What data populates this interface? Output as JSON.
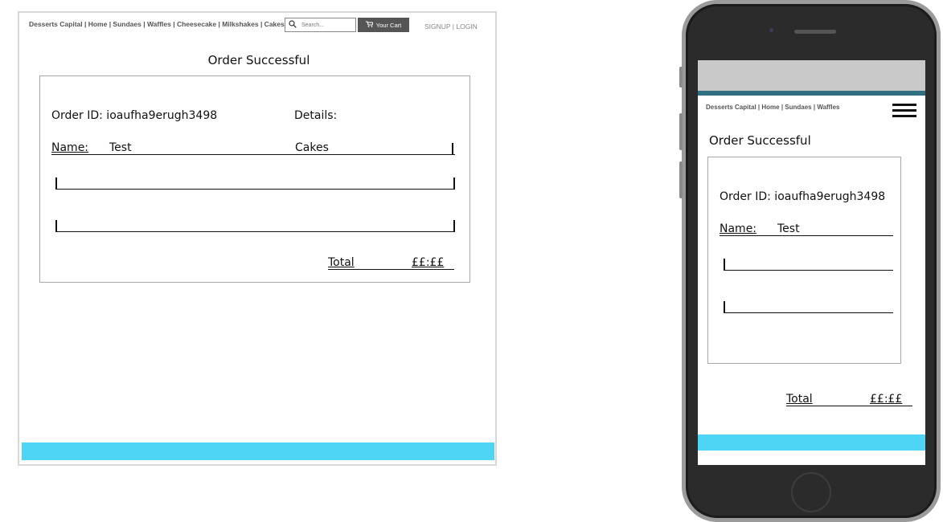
{
  "desktop": {
    "nav": "Desserts Capital | Home | Sundaes | Waffles | Cheesecake | Milkshakes | Cakes",
    "search_placeholder": "Search...",
    "cart_label": "Your Cart",
    "auth": "SIGNUP | LOGIN",
    "title": "Order Successful",
    "order_id_label": "Order ID: ioaufha9erugh3498",
    "details_label": "Details:",
    "name_label": "Name:",
    "name_value": "Test",
    "item": "Cakes",
    "total_label": "Total",
    "total_value": "££:££"
  },
  "mobile": {
    "nav": "Desserts Capital | Home | Sundaes | Waffles",
    "title": "Order Successful",
    "order_id_label": "Order ID: ioaufha9erugh3498",
    "name_label": "Name:",
    "name_value": "Test",
    "total_label": "Total",
    "total_value": "££:££"
  },
  "colors": {
    "footer": "#4ed5f6",
    "cart_button": "#555555",
    "phone_body": "#2b2b2b"
  }
}
